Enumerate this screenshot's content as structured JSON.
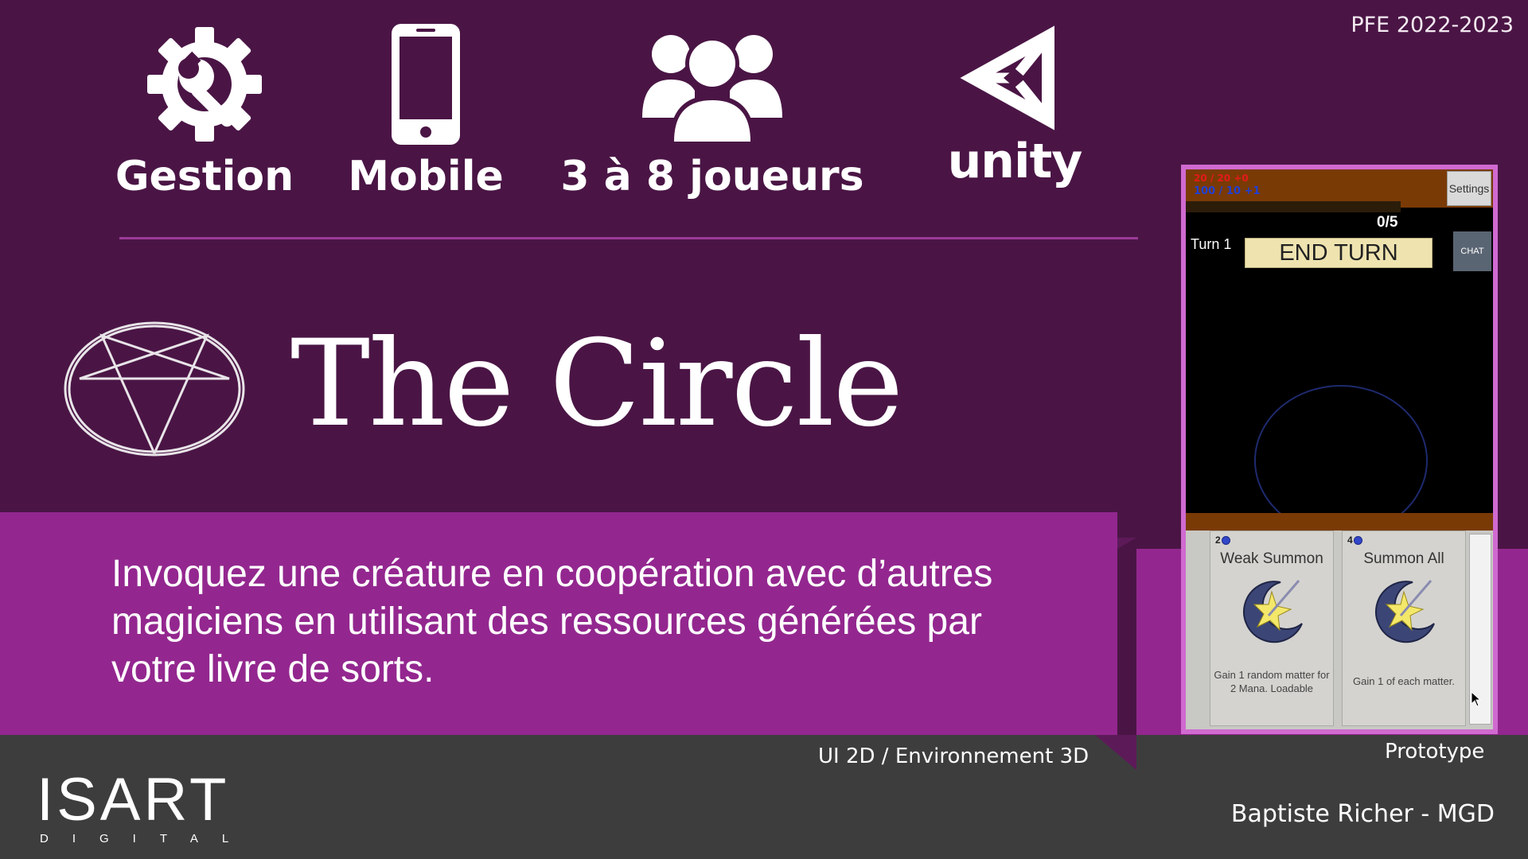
{
  "header": {
    "tag": "PFE 2022-2023"
  },
  "features": [
    {
      "label": "Gestion",
      "icon": "gear-wrench-icon"
    },
    {
      "label": "Mobile",
      "icon": "smartphone-icon"
    },
    {
      "label": "3 à 8 joueurs",
      "icon": "users-group-icon"
    },
    {
      "label": "unity",
      "icon": "unity-logo-icon"
    }
  ],
  "title": "The Circle",
  "description": "Invoquez une créature en coopération avec d’autres magiciens en utilisant des ressources générées par votre livre de sorts.",
  "captions": {
    "ui": "UI 2D / Environnement 3D",
    "prototype": "Prototype",
    "author": "Baptiste Richer - MGD"
  },
  "logo": {
    "main": "ISART",
    "sub": "DIGITAL"
  },
  "prototype_screen": {
    "resources_red": "20 / 20  +0",
    "resources_blue": "100 / 10  +1",
    "settings_label": "Settings",
    "counter": "0/5",
    "turn_label": "Turn 1",
    "end_turn_label": "END TURN",
    "chat_label": "CHAT",
    "cards": [
      {
        "cost": "2",
        "title": "Weak Summon",
        "desc": "Gain 1 random matter for 2 Mana. Loadable"
      },
      {
        "cost": "4",
        "title": "Summon All",
        "desc": "Gain 1 of each matter."
      }
    ]
  },
  "colors": {
    "background": "#4a1545",
    "band": "#93278f",
    "bottom_bar": "#3d3d3d",
    "phone_border": "#d06ad0",
    "end_turn_bg": "#efe4b0"
  }
}
